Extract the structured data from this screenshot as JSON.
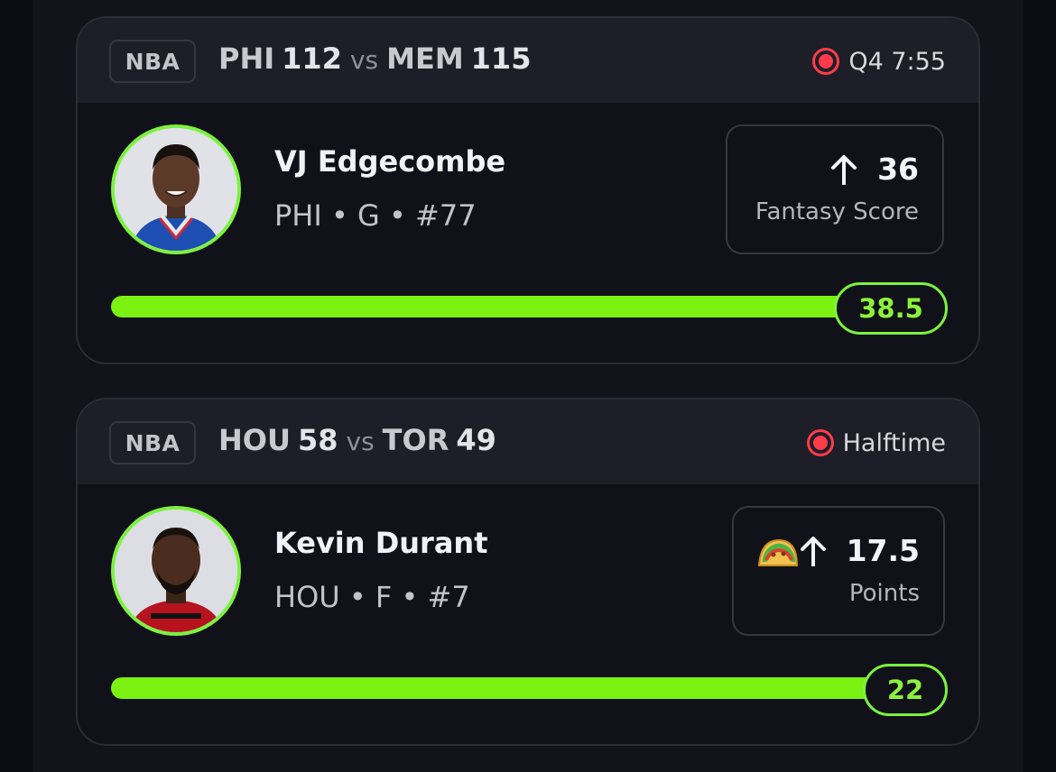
{
  "cards": [
    {
      "league": "NBA",
      "home_team": "PHI",
      "home_score": "112",
      "vs": "vs",
      "away_team": "MEM",
      "away_score": "115",
      "status": "Q4 7:55",
      "player": {
        "name": "VJ Edgecombe",
        "meta": "PHI • G • #77"
      },
      "stat": {
        "value": "36",
        "label": "Fantasy Score",
        "direction": "up",
        "emoji": ""
      },
      "line": "38.5",
      "progress_ratio": 0.935,
      "accent_color": "#7cf240"
    },
    {
      "league": "NBA",
      "home_team": "HOU",
      "home_score": "58",
      "vs": "vs",
      "away_team": "TOR",
      "away_score": "49",
      "status": "Halftime",
      "player": {
        "name": "Kevin Durant",
        "meta": "HOU • F • #7"
      },
      "stat": {
        "value": "17.5",
        "label": "Points",
        "direction": "up",
        "emoji": "taco"
      },
      "line": "22",
      "progress_ratio": 1.0,
      "accent_color": "#7cf240"
    }
  ],
  "colors": {
    "live": "#ff3b4a",
    "accent": "#7cf240",
    "background": "#12131b"
  }
}
